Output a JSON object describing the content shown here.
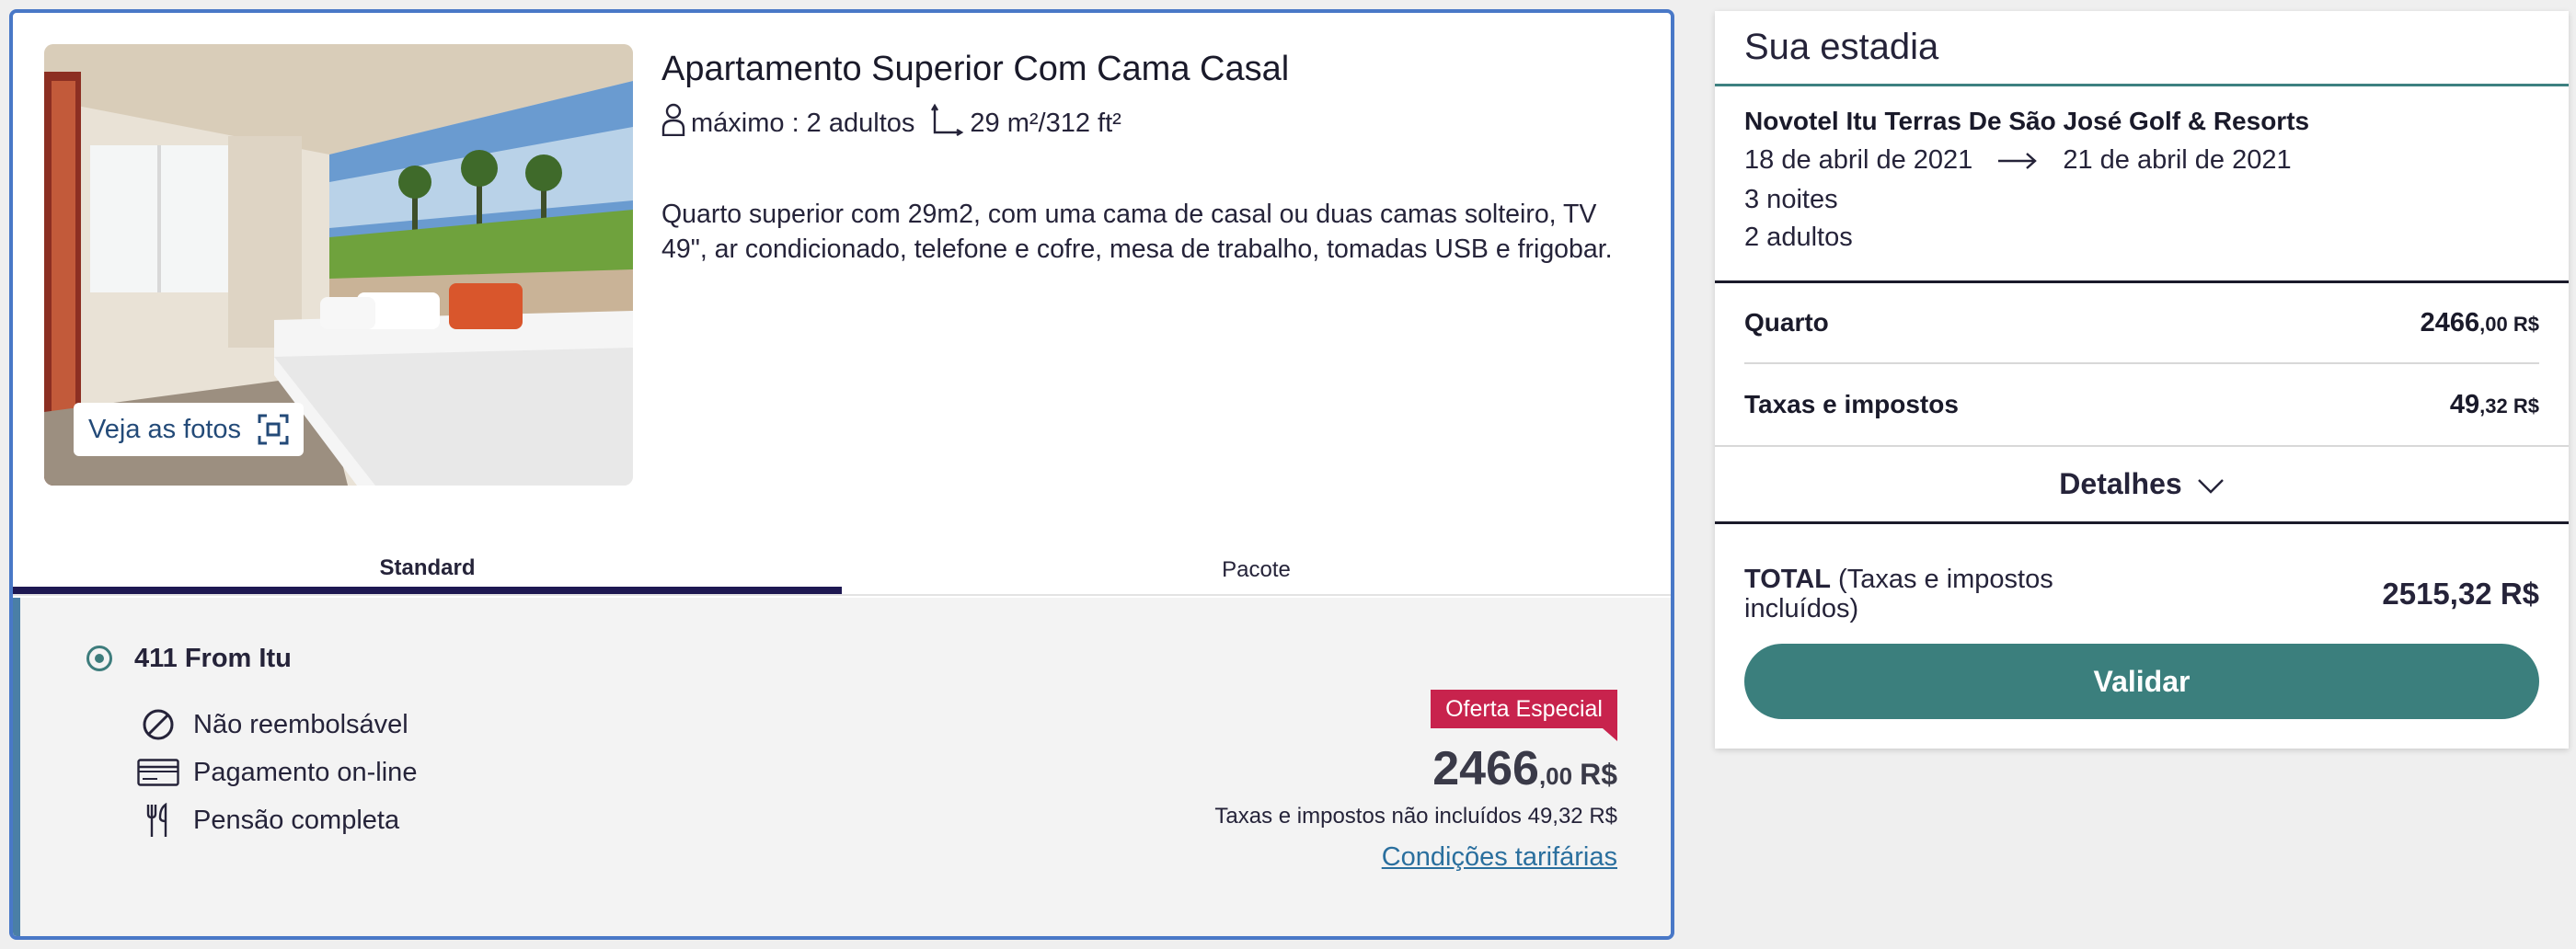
{
  "room": {
    "title": "Apartamento Superior Com Cama Casal",
    "capacity": "máximo : 2 adultos",
    "area": "29 m²/312 ft²",
    "description": "Quarto superior com 29m2, com uma cama de casal ou duas camas solteiro, TV 49\", ar condicionado, telefone e cofre, mesa de trabalho, tomadas USB e frigobar.",
    "photos_button": "Veja as fotos"
  },
  "tabs": [
    {
      "label": "Standard",
      "active": true
    },
    {
      "label": "Pacote",
      "active": false
    }
  ],
  "rate": {
    "name": "411 From Itu",
    "features": [
      {
        "icon": "no-refund-icon",
        "label": "Não reembolsável"
      },
      {
        "icon": "credit-card-icon",
        "label": "Pagamento on-line"
      },
      {
        "icon": "fork-knife-icon",
        "label": "Pensão completa"
      }
    ],
    "offer_badge": "Oferta Especial",
    "price_int": "2466",
    "price_dec": ",00",
    "price_currency": "R$",
    "tax_note": "Taxas e impostos não incluídos 49,32 R$",
    "conditions_link": "Condições tarifárias"
  },
  "summary": {
    "heading": "Sua estadia",
    "hotel": "Novotel Itu Terras De São José Golf & Resorts",
    "date_from": "18 de abril de 2021",
    "date_to": "21 de abril de 2021",
    "nights": "3 noites",
    "guests": "2 adultos",
    "room_label": "Quarto",
    "room_int": "2466",
    "room_dec": ",00 R$",
    "taxes_label": "Taxas e impostos",
    "taxes_int": "49",
    "taxes_dec": ",32 R$",
    "details_label": "Detalhes",
    "total_label": "TOTAL",
    "total_note": "(Taxas e impostos incluídos)",
    "total_value": "2515,32 R$",
    "validate_button": "Validar"
  },
  "colors": {
    "card_border": "#4978c7",
    "tab_active": "#1e1852",
    "offer_badge": "#c8234d",
    "link": "#2a6f9e",
    "validate_button": "#3b7f7d"
  }
}
